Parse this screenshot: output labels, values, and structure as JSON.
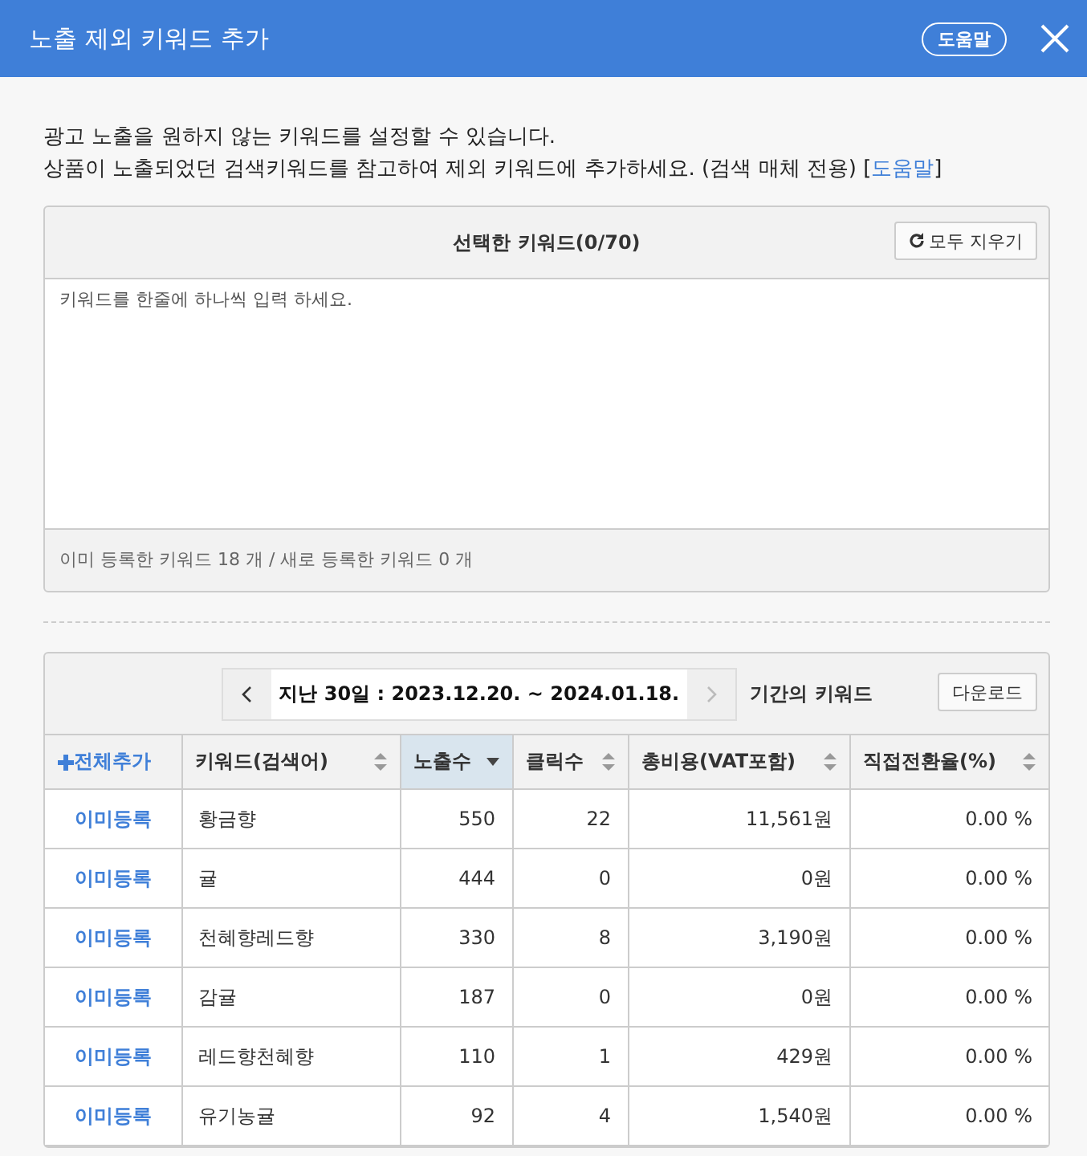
{
  "window": {
    "title": "노출 제외 키워드 추가",
    "help_button": "도움말"
  },
  "intro": {
    "line_1": "광고 노출을 원하지 않는 키워드를 설정할 수 있습니다.",
    "line_2": "상품이 노출되었던 검색키워드를 참고하여 제외 키워드에 추가하세요. (검색 매체 전용) [",
    "help_link": "도움말",
    "line_2_end": "]"
  },
  "keyword_panel": {
    "title": "선택한 키워드(0/70)",
    "clear_button": "모두 지우기",
    "placeholder": "키워드를 한줄에 하나씩 입력 하세요.",
    "summary": "이미 등록한 키워드 18 개 / 새로 등록한 키워드 0 개"
  },
  "period": {
    "range": "지난 30일 : 2023.12.20. ~ 2024.01.18.",
    "suffix": "기간의 키워드",
    "next_disabled": true,
    "download_button": "다운로드"
  },
  "table": {
    "columns": [
      {
        "label": "전체추가",
        "kind": "add"
      },
      {
        "label": "키워드(검색어)",
        "kind": "sort",
        "sorted": false
      },
      {
        "label": "노출수",
        "kind": "sort",
        "sorted": true
      },
      {
        "label": "클릭수",
        "kind": "sort",
        "sorted": false
      },
      {
        "label": "총비용(VAT포함)",
        "kind": "sort",
        "sorted": false
      },
      {
        "label": "직접전환율(%)",
        "kind": "sort",
        "sorted": false
      }
    ],
    "rows": [
      {
        "status": "이미등록",
        "keyword": "황금향",
        "impressions": "550",
        "clicks": "22",
        "cost": "11,561원",
        "conversion": "0.00 %"
      },
      {
        "status": "이미등록",
        "keyword": "귤",
        "impressions": "444",
        "clicks": "0",
        "cost": "0원",
        "conversion": "0.00 %"
      },
      {
        "status": "이미등록",
        "keyword": "천혜향레드향",
        "impressions": "330",
        "clicks": "8",
        "cost": "3,190원",
        "conversion": "0.00 %"
      },
      {
        "status": "이미등록",
        "keyword": "감귤",
        "impressions": "187",
        "clicks": "0",
        "cost": "0원",
        "conversion": "0.00 %"
      },
      {
        "status": "이미등록",
        "keyword": "레드향천혜향",
        "impressions": "110",
        "clicks": "1",
        "cost": "429원",
        "conversion": "0.00 %"
      },
      {
        "status": "이미등록",
        "keyword": "유기농귤",
        "impressions": "92",
        "clicks": "4",
        "cost": "1,540원",
        "conversion": "0.00 %"
      }
    ]
  }
}
